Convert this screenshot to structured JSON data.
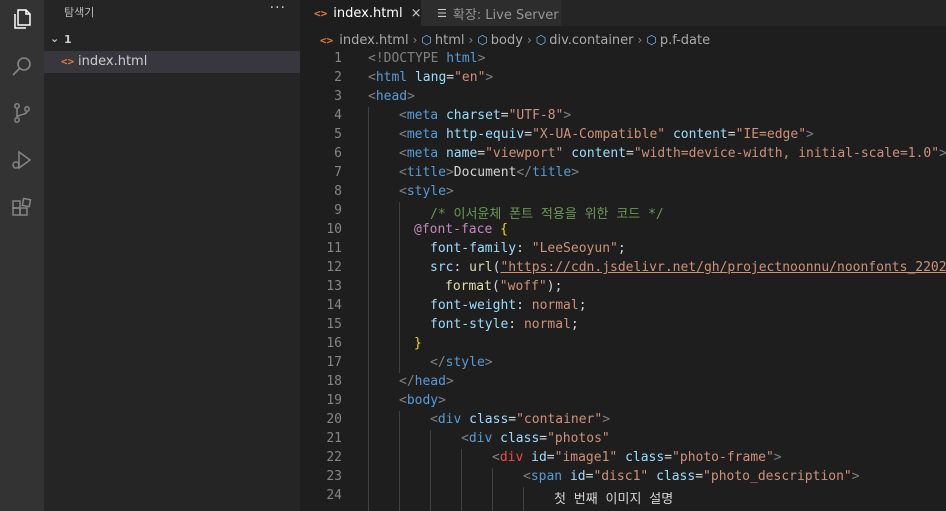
{
  "activity_bar": {
    "icons": [
      "files-icon",
      "search-icon",
      "source-control-icon",
      "run-debug-icon",
      "extensions-icon"
    ]
  },
  "sidebar": {
    "title": "탐색기",
    "more": "···",
    "folder": {
      "chevron": "⌄",
      "name": "1"
    },
    "file": {
      "icon": "<>",
      "name": "index.html"
    }
  },
  "tabs": {
    "active": {
      "icon": "<>",
      "label": "index.html",
      "close": "×"
    },
    "inactive": {
      "icon": "☰",
      "label": "확장: Live Server"
    }
  },
  "breadcrumb": {
    "file": "index.html",
    "items": [
      "html",
      "body",
      "div.container",
      "p.f-date"
    ],
    "separator": "›"
  },
  "editor": {
    "lines": [
      "1",
      "2",
      "3",
      "4",
      "5",
      "6",
      "7",
      "8",
      "9",
      "10",
      "11",
      "12",
      "13",
      "14",
      "15",
      "16",
      "17",
      "18",
      "19",
      "20",
      "21",
      "22",
      "23",
      "24"
    ],
    "code": {
      "l1": {
        "a": "<!DOCTYPE ",
        "b": "html",
        "c": ">"
      },
      "l2": {
        "a": "<",
        "b": "html",
        "c": " lang",
        "d": "=",
        "e": "\"en\"",
        "f": ">"
      },
      "l3": {
        "a": "<",
        "b": "head",
        "c": ">"
      },
      "l4": {
        "a": "<",
        "b": "meta",
        "c": " charset",
        "d": "=",
        "e": "\"UTF-8\"",
        "f": ">"
      },
      "l5": {
        "a": "<",
        "b": "meta",
        "c": " http-equiv",
        "d": "=",
        "e": "\"X-UA-Compatible\"",
        "f": " content",
        "g": "=",
        "h": "\"IE=edge\"",
        "i": ">"
      },
      "l6": {
        "a": "<",
        "b": "meta",
        "c": " name",
        "d": "=",
        "e": "\"viewport\"",
        "f": " content",
        "g": "=",
        "h": "\"width=device-width, initial-scale=1.0\"",
        "i": ">"
      },
      "l7": {
        "a": "<",
        "b": "title",
        "c": ">",
        "d": "Document",
        "e": "</",
        "f": "title",
        "g": ">"
      },
      "l8": {
        "a": "<",
        "b": "style",
        "c": ">"
      },
      "l9": {
        "a": "/* 이서윤체 폰트 적용을 위한 코드 */"
      },
      "l10": {
        "a": "@font-face",
        "b": " {"
      },
      "l11": {
        "a": "font-family",
        "b": ": ",
        "c": "\"LeeSeoyun\"",
        "d": ";"
      },
      "l12": {
        "a": "src",
        "b": ": ",
        "c": "url",
        "d": "(",
        "e": "\"https://cdn.jsdelivr.net/gh/projectnoonnu/noonfonts_2202"
      },
      "l13": {
        "a": "format",
        "b": "(",
        "c": "\"woff\"",
        "d": ");"
      },
      "l14": {
        "a": "font-weight",
        "b": ": ",
        "c": "normal",
        "d": ";"
      },
      "l15": {
        "a": "font-style",
        "b": ": ",
        "c": "normal",
        "d": ";"
      },
      "l16": {
        "a": "}"
      },
      "l17": {
        "a": "</",
        "b": "style",
        "c": ">"
      },
      "l18": {
        "a": "</",
        "b": "head",
        "c": ">"
      },
      "l19": {
        "a": "<",
        "b": "body",
        "c": ">"
      },
      "l20": {
        "a": "<",
        "b": "div",
        "c": " class",
        "d": "=",
        "e": "\"container\"",
        "f": ">"
      },
      "l21": {
        "a": "<",
        "b": "div",
        "c": " class",
        "d": "=",
        "e": "\"photos\""
      },
      "l22": {
        "a": "<",
        "b": "div",
        "c": " id",
        "d": "=",
        "e": "\"image1\"",
        "f": " class",
        "g": "=",
        "h": "\"photo-frame\"",
        "i": ">"
      },
      "l23": {
        "a": "<",
        "b": "span",
        "c": " id",
        "d": "=",
        "e": "\"disc1\"",
        "f": " class",
        "g": "=",
        "h": "\"photo_description\"",
        "i": ">"
      },
      "l24": {
        "a": "첫 번째 이미지 설명"
      }
    }
  }
}
